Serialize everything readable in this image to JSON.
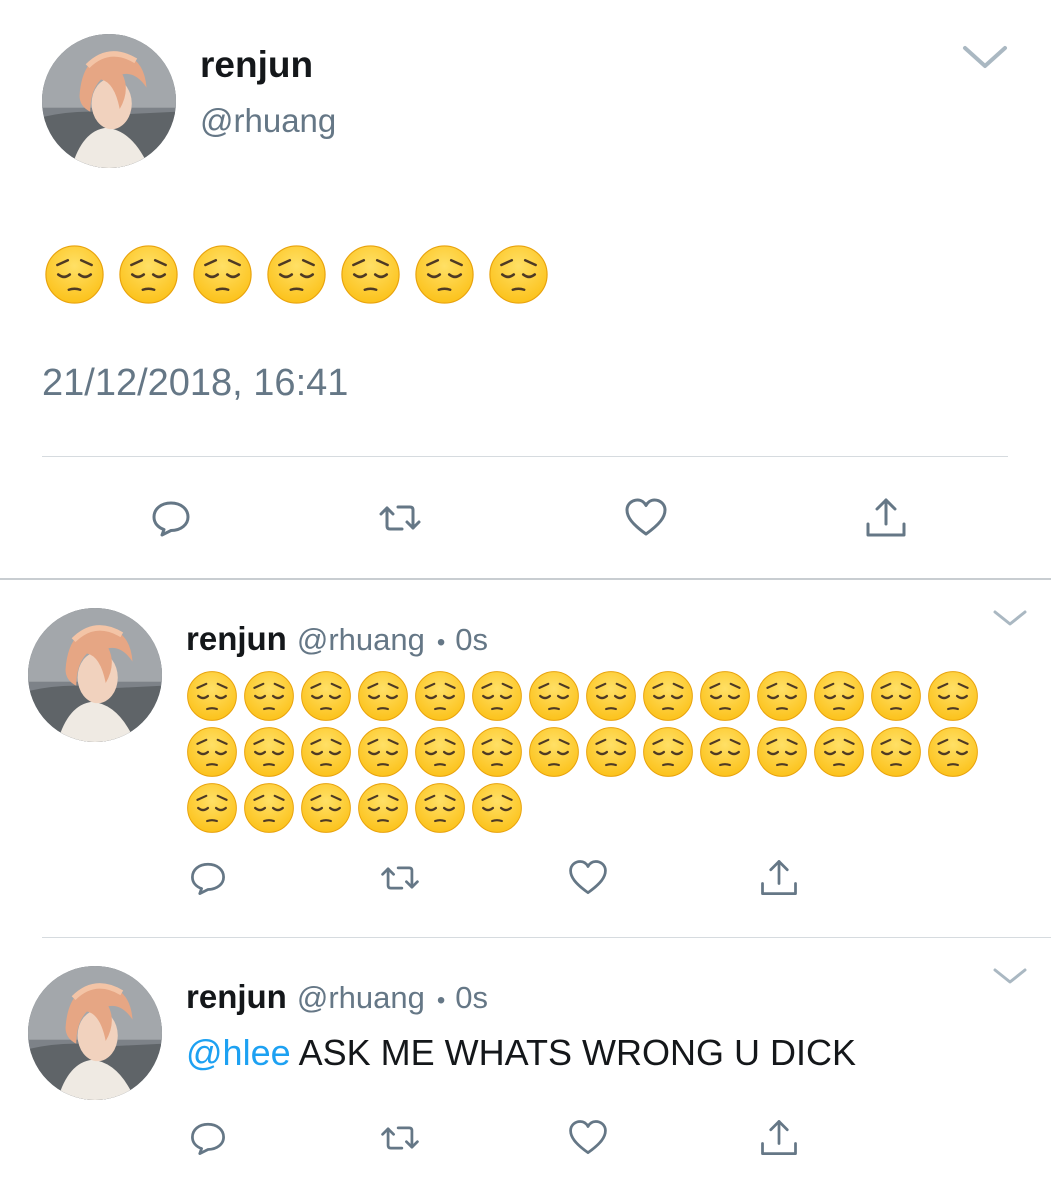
{
  "main_tweet": {
    "display_name": "renjun",
    "handle": "@rhuang",
    "emoji_count": 7,
    "emoji_name": "pensive-face",
    "timestamp": "21/12/2018, 16:41",
    "actions": [
      "reply-icon",
      "retweet-icon",
      "like-icon",
      "share-icon"
    ],
    "avatar_icon": "profile-photo"
  },
  "replies": [
    {
      "display_name": "renjun",
      "handle": "@rhuang",
      "separator": "•",
      "time": "0s",
      "emoji_count": 34,
      "emoji_name": "pensive-face",
      "actions": [
        "reply-icon",
        "retweet-icon",
        "like-icon",
        "share-icon"
      ]
    },
    {
      "display_name": "renjun",
      "handle": "@rhuang",
      "separator": "•",
      "time": "0s",
      "mention": "@hlee",
      "text": " ASK ME WHATS WRONG U DICK",
      "actions": [
        "reply-icon",
        "retweet-icon",
        "like-icon",
        "share-icon"
      ]
    }
  ],
  "colors": {
    "name": "#14171a",
    "secondary": "#657786",
    "link": "#1da1f2",
    "divider": "#d6dbdf",
    "icon": "#657786",
    "emoji_face": "#fcc21b"
  }
}
